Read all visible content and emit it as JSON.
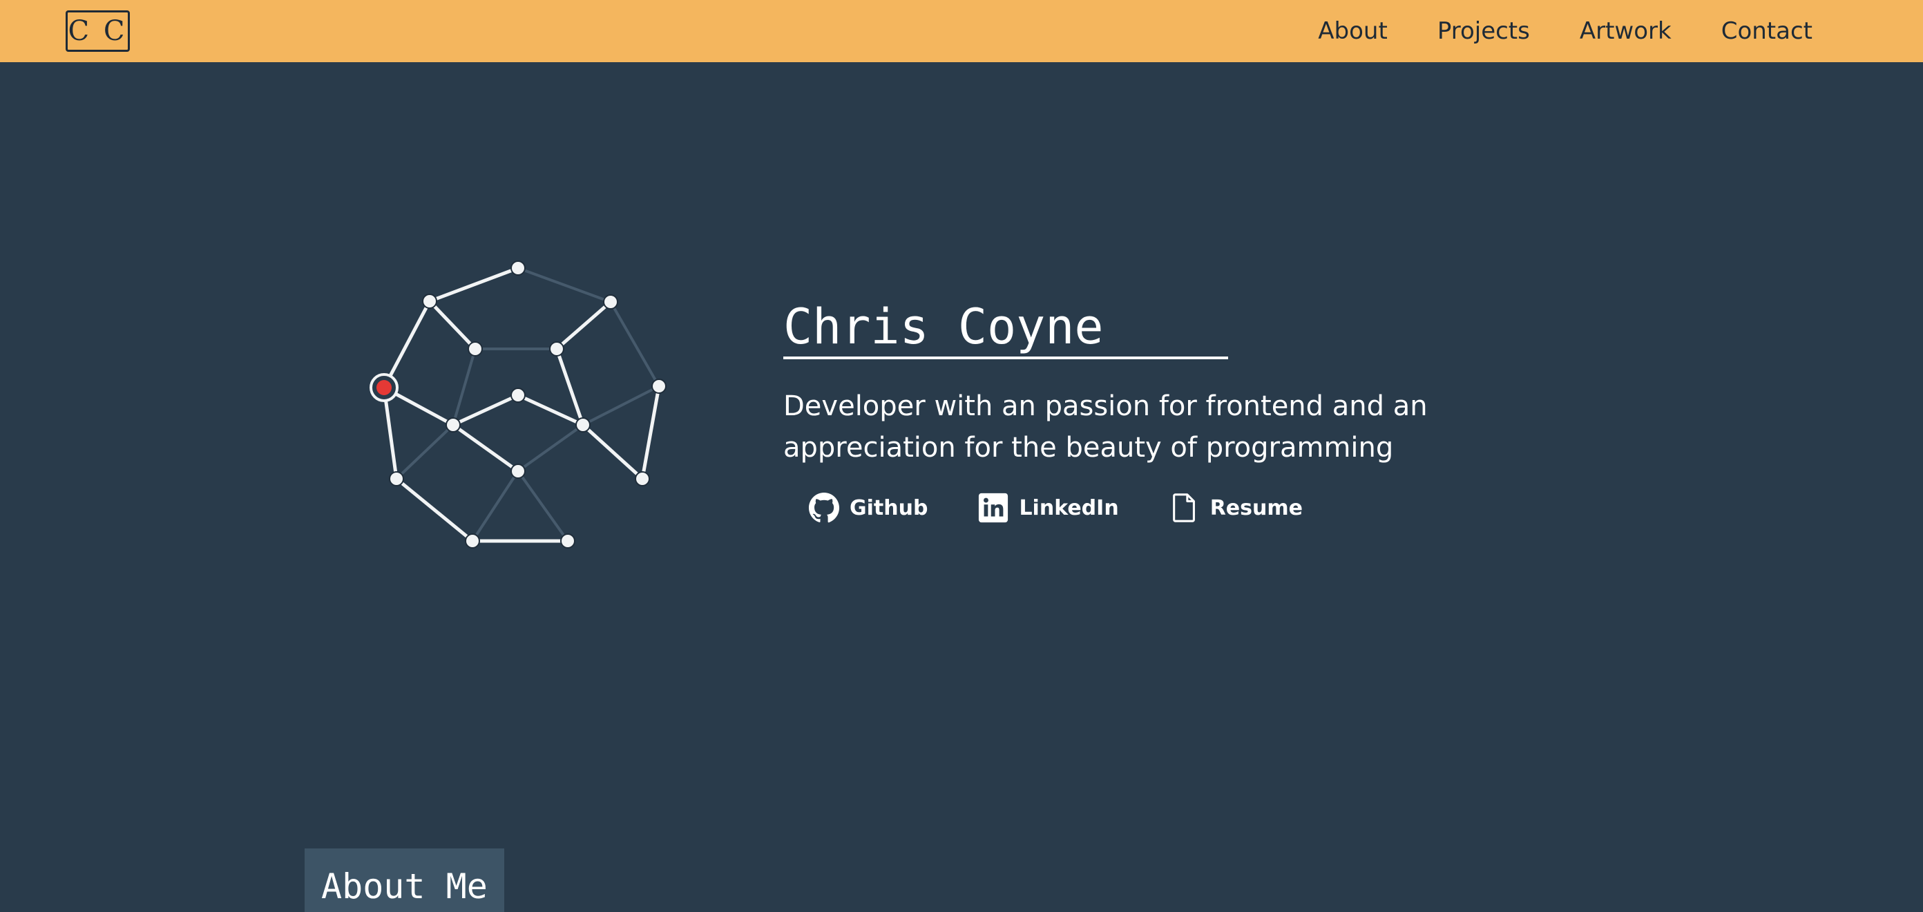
{
  "header": {
    "logo_text": "C C",
    "nav": [
      {
        "label": "About"
      },
      {
        "label": "Projects"
      },
      {
        "label": "Artwork"
      },
      {
        "label": "Contact"
      }
    ]
  },
  "hero": {
    "name": "Chris Coyne",
    "tagline": "Developer with an passion for frontend and an appreciation for the beauty of programming",
    "links": [
      {
        "label": "Github",
        "icon": "github-icon"
      },
      {
        "label": "LinkedIn",
        "icon": "linkedin-icon"
      },
      {
        "label": "Resume",
        "icon": "document-icon"
      }
    ],
    "graph_active_color": "#e53935"
  },
  "about": {
    "heading": "About Me"
  },
  "colors": {
    "header_bg": "#f4b65e",
    "page_bg": "#293b4b",
    "text_dark": "#1e2a36",
    "text_light": "#ffffff",
    "accent_red": "#e53935"
  }
}
